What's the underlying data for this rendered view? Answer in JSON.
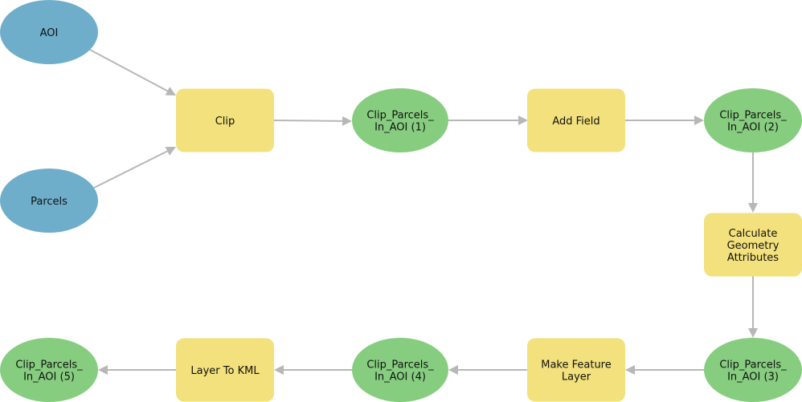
{
  "diagram": {
    "type": "model-builder-workflow",
    "colors": {
      "input_data": "#6eaecb",
      "tool": "#f2e17c",
      "derived_data": "#86cd7f",
      "connector": "#b7b7b7",
      "text": "#111111"
    },
    "nodes": [
      {
        "id": "aoi",
        "kind": "input_data",
        "shape": "ellipse",
        "lines": [
          "AOI"
        ]
      },
      {
        "id": "parcels",
        "kind": "input_data",
        "shape": "ellipse",
        "lines": [
          "Parcels"
        ]
      },
      {
        "id": "clip",
        "kind": "tool",
        "shape": "rect",
        "lines": [
          "Clip"
        ]
      },
      {
        "id": "out1",
        "kind": "derived_data",
        "shape": "ellipse",
        "lines": [
          "Clip_Parcels_",
          "In_AOI (1)"
        ]
      },
      {
        "id": "addfield",
        "kind": "tool",
        "shape": "rect",
        "lines": [
          "Add Field"
        ]
      },
      {
        "id": "out2",
        "kind": "derived_data",
        "shape": "ellipse",
        "lines": [
          "Clip_Parcels_",
          "In_AOI (2)"
        ]
      },
      {
        "id": "calcgeom",
        "kind": "tool",
        "shape": "rect",
        "lines": [
          "Calculate",
          "Geometry",
          "Attributes"
        ]
      },
      {
        "id": "out3",
        "kind": "derived_data",
        "shape": "ellipse",
        "lines": [
          "Clip_Parcels_",
          "In_AOI (3)"
        ]
      },
      {
        "id": "mfl",
        "kind": "tool",
        "shape": "rect",
        "lines": [
          "Make Feature",
          "Layer"
        ]
      },
      {
        "id": "out4",
        "kind": "derived_data",
        "shape": "ellipse",
        "lines": [
          "Clip_Parcels_",
          "In_AOI (4)"
        ]
      },
      {
        "id": "l2kml",
        "kind": "tool",
        "shape": "rect",
        "lines": [
          "Layer To KML"
        ]
      },
      {
        "id": "out5",
        "kind": "derived_data",
        "shape": "ellipse",
        "lines": [
          "Clip_Parcels_",
          "In_AOI (5)"
        ]
      }
    ],
    "edges": [
      {
        "from": "aoi",
        "to": "clip"
      },
      {
        "from": "parcels",
        "to": "clip"
      },
      {
        "from": "clip",
        "to": "out1"
      },
      {
        "from": "out1",
        "to": "addfield"
      },
      {
        "from": "addfield",
        "to": "out2"
      },
      {
        "from": "out2",
        "to": "calcgeom"
      },
      {
        "from": "calcgeom",
        "to": "out3"
      },
      {
        "from": "out3",
        "to": "mfl"
      },
      {
        "from": "mfl",
        "to": "out4"
      },
      {
        "from": "out4",
        "to": "l2kml"
      },
      {
        "from": "l2kml",
        "to": "out5"
      }
    ]
  }
}
